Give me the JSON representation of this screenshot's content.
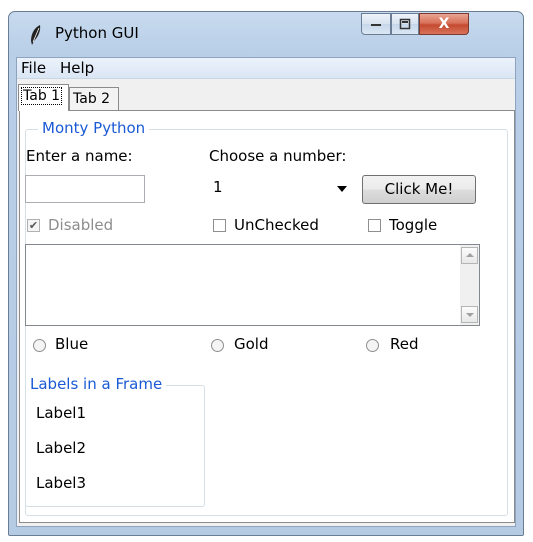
{
  "window": {
    "title": "Python GUI",
    "close_label": "X"
  },
  "menu": {
    "file": "File",
    "help": "Help"
  },
  "tabs": [
    {
      "label": "Tab 1"
    },
    {
      "label": "Tab 2"
    }
  ],
  "monty": {
    "frame_title": "Monty Python",
    "name_label": "Enter a name:",
    "name_value": "",
    "number_label": "Choose a number:",
    "number_value": "1",
    "click_button": "Click Me!",
    "check_disabled": {
      "label": "Disabled",
      "checked": true
    },
    "check_unchecked": {
      "label": "UnChecked",
      "checked": false
    },
    "check_toggle": {
      "label": "Toggle",
      "checked": false
    },
    "scrolled_text": "",
    "radios": [
      {
        "label": "Blue"
      },
      {
        "label": "Gold"
      },
      {
        "label": "Red"
      }
    ]
  },
  "labels_frame": {
    "title": "Labels in a Frame",
    "labels": [
      "Label1",
      "Label2",
      "Label3"
    ]
  }
}
